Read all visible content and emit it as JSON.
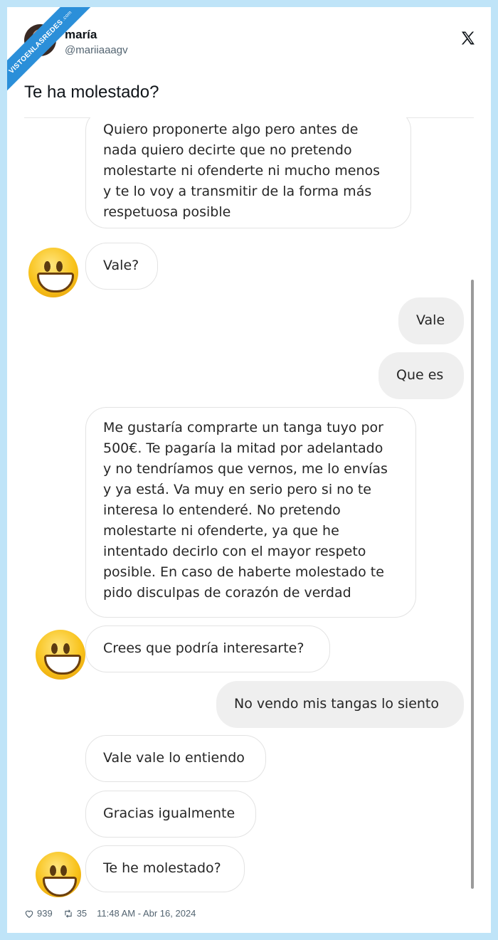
{
  "watermark": {
    "text": "VISTOENLASREDES",
    "suffix": ".com"
  },
  "author": {
    "name": "maría",
    "handle": "@mariiaaagv"
  },
  "icons": {
    "close": "x-logo-icon",
    "like": "heart-icon",
    "retweet": "retweet-icon"
  },
  "tweet": {
    "text": "Te ha molestado?"
  },
  "chat": {
    "messages": [
      {
        "side": "in",
        "text": "Quiero proponerte algo pero antes de\nnada quiero decirte que no pretendo\nmolestarte ni ofenderte ni mucho menos\ny te lo voy a transmitir de la forma más\nrespetuosa posible"
      },
      {
        "side": "in",
        "text": "Vale?"
      },
      {
        "side": "out",
        "text": "Vale"
      },
      {
        "side": "out",
        "text": "Que es"
      },
      {
        "side": "in",
        "text": "Me gustaría comprarte un tanga tuyo por\n500€. Te pagaría la mitad por adelantado\ny no tendríamos que vernos, me lo envías\ny ya está. Va muy en serio pero si no te\ninteresa lo entenderé. No pretendo\nmolestarte ni ofenderte, ya que he\nintentado decirlo con el mayor respeto\nposible. En caso de haberte molestado te\npido disculpas de corazón de verdad"
      },
      {
        "side": "in",
        "text": "Crees que podría interesarte?"
      },
      {
        "side": "out",
        "text": "No vendo mis tangas lo siento"
      },
      {
        "side": "in",
        "text": "Vale vale lo entiendo"
      },
      {
        "side": "in",
        "text": "Gracias igualmente"
      },
      {
        "side": "in",
        "text": "Te he molestado?"
      }
    ]
  },
  "stats": {
    "likes": "939",
    "retweets": "35",
    "timestamp": "11:48 AM - Abr 16, 2024"
  },
  "colors": {
    "background": "#bfe4f8",
    "watermark": "#2b8fd9",
    "bubble_out": "#efefef",
    "emoji": "#f8c21a"
  }
}
